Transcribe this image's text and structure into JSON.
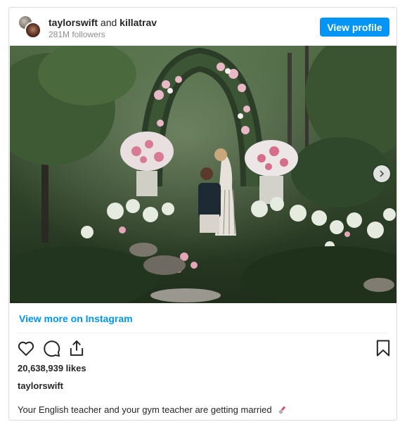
{
  "header": {
    "user1": "taylorswift",
    "conjunction": "and",
    "user2": "killatrav",
    "followers": "281M followers",
    "view_profile_label": "View profile"
  },
  "post": {
    "view_more_label": "View more on Instagram",
    "likes": "20,638,939 likes",
    "owner": "taylorswift",
    "caption": "Your English teacher and your gym teacher are getting married"
  },
  "icons": {
    "like": "heart-icon",
    "comment": "comment-icon",
    "share": "share-icon",
    "save": "bookmark-icon",
    "next": "chevron-right-icon",
    "caption_emoji": "lipstick-icon"
  },
  "colors": {
    "accent": "#0095f6",
    "text": "#262626",
    "muted": "#8e8e8e"
  }
}
